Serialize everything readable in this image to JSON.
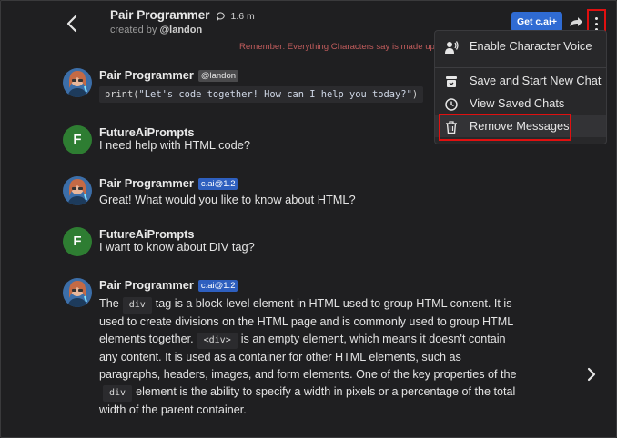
{
  "header": {
    "title": "Pair Programmer",
    "chat_count": "1.6 m",
    "created_by_prefix": "created by",
    "created_by_user": "@landon",
    "get_button": "Get c.ai+",
    "notice": "Remember: Everything Characters say is made up!"
  },
  "menu": {
    "items": [
      {
        "label": "Enable Character Voice",
        "icon": "voice-icon"
      },
      {
        "label": "Save and Start New Chat",
        "icon": "archive-icon"
      },
      {
        "label": "View Saved Chats",
        "icon": "history-icon"
      },
      {
        "label": "Remove Messages",
        "icon": "trash-icon"
      }
    ]
  },
  "messages": [
    {
      "author": "Pair Programmer",
      "badge": "@landon",
      "code_fn": "print(",
      "code_str": "\"Let's code together! How can I help you today?\"",
      "code_end": ")"
    },
    {
      "author": "FutureAiPrompts",
      "avatar_letter": "F",
      "text": "I need help with HTML code?"
    },
    {
      "author": "Pair Programmer",
      "badge": "c.ai@1.2",
      "text": "Great! What would you like to know about HTML?"
    },
    {
      "author": "FutureAiPrompts",
      "avatar_letter": "F",
      "text": "I want to know about DIV tag?"
    },
    {
      "author": "Pair Programmer",
      "badge": "c.ai@1.2",
      "p1": "The",
      "c1": "div",
      "p2": "tag is a block-level element in HTML used to group HTML content. It is used to create divisions on the HTML page and is commonly used to group HTML elements together.",
      "c2": "<div>",
      "p3": "is an empty element, which means it doesn't contain any content. It is used as a container for other HTML elements, such as paragraphs, headers, images, and form elements. One of the key properties of the",
      "c3": "div",
      "p4": "element is the ability to specify a width in pixels or a percentage of the total width of the parent container."
    }
  ],
  "colors": {
    "accent": "#2f6bd3",
    "highlight_box": "#e01010",
    "avatar_user": "#2e7d32",
    "background": "#1f1f21"
  }
}
